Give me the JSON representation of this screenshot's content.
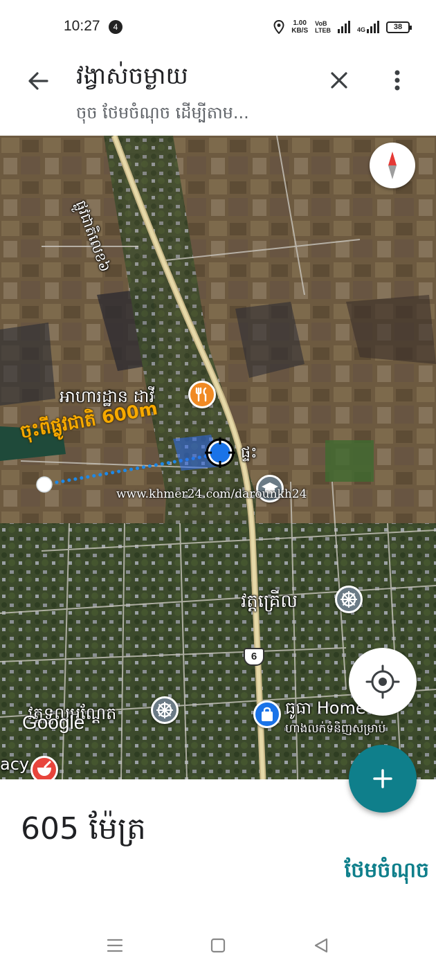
{
  "status_bar": {
    "time": "10:27",
    "notification_count": "4",
    "speed_value": "1.00",
    "speed_unit": "KB/S",
    "volte_top": "VoB",
    "volte_bottom": "LTEB",
    "network_4g": "4G",
    "battery": "38"
  },
  "header": {
    "title": "វង្វាស់ចម្ងាយ",
    "subtitle": "ចុច ថែមចំណុច ដើម្បីតាម..."
  },
  "map": {
    "road_label": "ផ្លូវជាតិលេខ៦",
    "restaurant_label": "អាហារដ្ឋាន ដាវី",
    "annotation": "ចុះពីផ្លូវជាតិ 600m",
    "house_label": "ផ្ទះ",
    "watermark": "www.khmer24.com/darounkh24",
    "pagoda1_label": "វត្តគ្រើល",
    "route_shield": "6",
    "pagoda2_label": "វត្តទួលអណ្តែត",
    "shop_label_line1": "ធូធា Home",
    "shop_label_line2": "ហាងលក់ទំនិញសម្រាប់",
    "pharmacy_label": "acy",
    "google_logo": "Google"
  },
  "bottom": {
    "distance": "605 ម៉ែត្រ",
    "add_point": "ថែមចំណុច"
  },
  "colors": {
    "accent": "#0f7f8b",
    "restaurant_pin": "#f08a24",
    "poi_gray": "#6b7b86",
    "shop_pin": "#1a73e8",
    "measure_line": "#1e88e5",
    "annotation": "#f7a900"
  }
}
